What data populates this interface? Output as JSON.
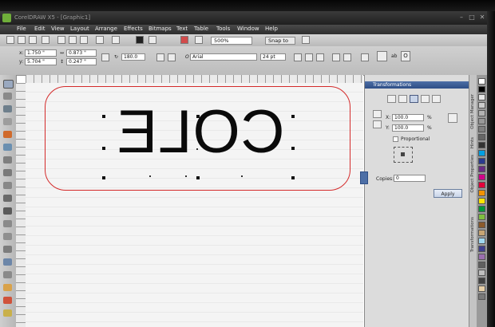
{
  "window": {
    "title": "CorelDRAW X5 - [Graphic1]"
  },
  "menu": [
    "File",
    "Edit",
    "View",
    "Layout",
    "Arrange",
    "Effects",
    "Bitmaps",
    "Text",
    "Table",
    "Tools",
    "Window",
    "Help"
  ],
  "standard_toolbar": {
    "zoom": "500%",
    "snap_to": "Snap to"
  },
  "property_bar": {
    "x": "1.750 \"",
    "y": "5.704 \"",
    "width": "0.873 \"",
    "height": "0.247 \"",
    "rotation": "180.0",
    "font_name": "Arial",
    "font_size": "24 pt",
    "font_icon_label": "O"
  },
  "canvas": {
    "text": "COLE",
    "text_mirrored": true,
    "plate_outline_color": "#d42a2a"
  },
  "docker": {
    "title": "Transformations",
    "x_label": "X:",
    "x_value": "100.0",
    "y_label": "Y:",
    "y_value": "100.0",
    "percent": "%",
    "proportional_label": "Proportional",
    "copies_label": "Copies:",
    "copies_value": "0",
    "apply_label": "Apply"
  },
  "side_tabs": [
    "Object Manager",
    "Hints",
    "Object Properties",
    "Transformations"
  ],
  "palette_colors": [
    "#ffffff",
    "#000000",
    "#e6e6e6",
    "#cccccc",
    "#b3b3b3",
    "#999999",
    "#808080",
    "#666666",
    "#333333",
    "#00a0e3",
    "#2a3b8f",
    "#6b2d86",
    "#d1008a",
    "#e4003b",
    "#f39200",
    "#ffe600",
    "#00983a",
    "#7fbf3f",
    "#8b5a2b",
    "#c7a574",
    "#a0d8f0",
    "#3f3f8f",
    "#9b6fb0",
    "#5f5f5f",
    "#c0c0c0",
    "#404040",
    "#e8d0a8",
    "#7a7a7a"
  ]
}
